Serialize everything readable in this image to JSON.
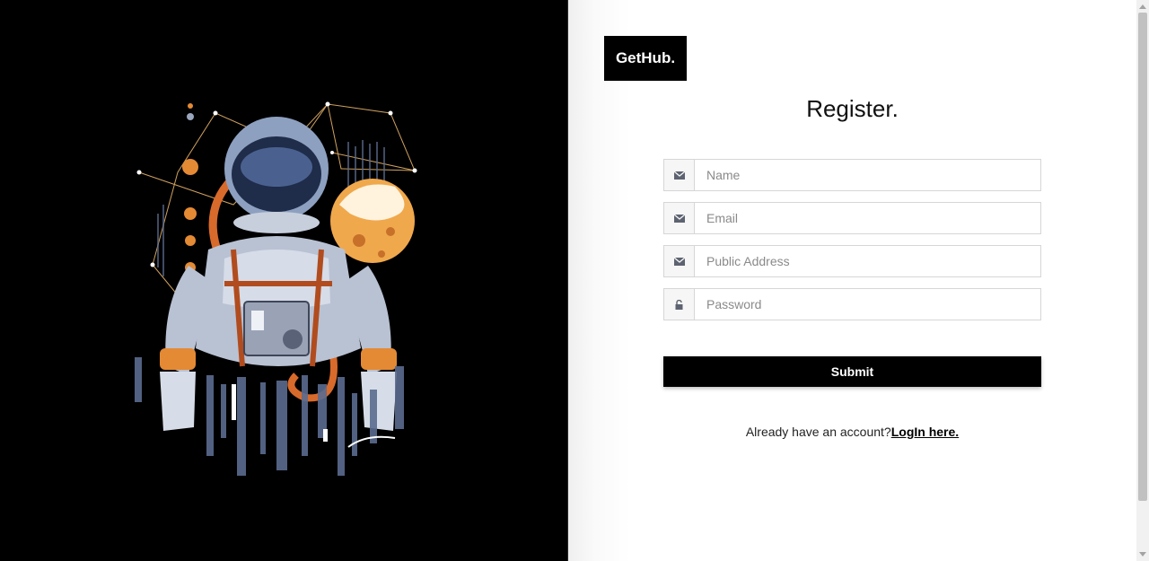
{
  "brand": {
    "logo_text": "GetHub."
  },
  "form": {
    "title": "Register.",
    "fields": [
      {
        "icon": "envelope-icon",
        "placeholder": "Name",
        "value": ""
      },
      {
        "icon": "envelope-icon",
        "placeholder": "Email",
        "value": ""
      },
      {
        "icon": "envelope-icon",
        "placeholder": "Public Address",
        "value": ""
      },
      {
        "icon": "lock-icon",
        "placeholder": "Password",
        "value": ""
      }
    ],
    "submit_label": "Submit",
    "login_prompt": "Already have an account?",
    "login_link": "LogIn here."
  },
  "hero": {
    "illustration": "astronaut-illustration"
  },
  "colors": {
    "panel_dark": "#000000",
    "button_bg": "#000000",
    "button_text": "#ffffff"
  }
}
